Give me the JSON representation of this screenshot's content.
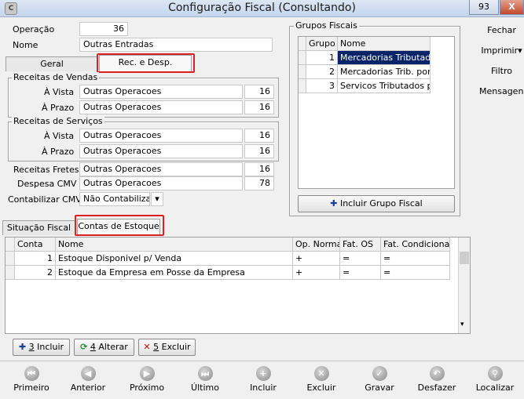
{
  "window": {
    "title": "Configuração Fiscal (Consultando)",
    "app_icon": "C",
    "code_badge": "93",
    "close_glyph": "X"
  },
  "header": {
    "operacao_label": "Operação",
    "operacao_value": "36",
    "nome_label": "Nome",
    "nome_value": "Outras Entradas"
  },
  "top_tabs": [
    {
      "label": "Geral"
    },
    {
      "label": "Rec. e Desp."
    }
  ],
  "receitas_vendas": {
    "title": "Receitas de Vendas",
    "rows": [
      {
        "label": "À Vista",
        "value": "Outras Operacoes",
        "code": "16"
      },
      {
        "label": "À Prazo",
        "value": "Outras Operacoes",
        "code": "16"
      }
    ]
  },
  "receitas_servicos": {
    "title": "Receitas de Serviços",
    "rows": [
      {
        "label": "À Vista",
        "value": "Outras Operacoes",
        "code": "16"
      },
      {
        "label": "À Prazo",
        "value": "Outras Operacoes",
        "code": "16"
      }
    ]
  },
  "extras": {
    "fretes_label": "Receitas Fretes",
    "fretes_value": "Outras Operacoes",
    "fretes_code": "16",
    "cmv_label": "Despesa CMV",
    "cmv_value": "Outras Operacoes",
    "cmv_code": "78",
    "contabilizar_label": "Contabilizar CMV",
    "contabilizar_value": "Não Contabilizar"
  },
  "grupos_fiscais": {
    "title": "Grupos Fiscais",
    "headers": [
      "Grupo",
      "Nome"
    ],
    "rows": [
      {
        "grupo": "1",
        "nome": "Mercadorias Tributadas"
      },
      {
        "grupo": "2",
        "nome": "Mercadorias Trib. por Su"
      },
      {
        "grupo": "3",
        "nome": "Servicos Tributados pel"
      }
    ],
    "button_label": "Incluir Grupo Fiscal"
  },
  "bottom_tabs": [
    {
      "label": "Situação Fiscal"
    },
    {
      "label": "Contas de Estoque"
    }
  ],
  "contas": {
    "headers": [
      "Conta",
      "Nome",
      "Op. Normal",
      "Fat. OS",
      "Fat. Condicional"
    ],
    "rows": [
      {
        "conta": "1",
        "nome": "Estoque Disponivel p/ Venda",
        "op": "+",
        "os": "=",
        "cond": "="
      },
      {
        "conta": "2",
        "nome": "Estoque da Empresa em Posse da Empresa",
        "op": "+",
        "os": "=",
        "cond": "="
      }
    ]
  },
  "actions": {
    "incluir_key": "3",
    "incluir_label": " Incluir",
    "alterar_key": "4",
    "alterar_label": " Alterar",
    "excluir_key": "5",
    "excluir_label": " Excluir"
  },
  "side_menu": {
    "fechar": "Fechar",
    "imprimir": "Imprimir",
    "filtro": "Filtro",
    "mensagens": "Mensagens"
  },
  "nav": [
    {
      "label": "Primeiro",
      "icon": "first-icon"
    },
    {
      "label": "Anterior",
      "icon": "prev-icon"
    },
    {
      "label": "Próximo",
      "icon": "next-icon"
    },
    {
      "label": "Último",
      "icon": "last-icon"
    },
    {
      "label": "Incluir",
      "icon": "plus-icon"
    },
    {
      "label": "Excluir",
      "icon": "x-icon"
    },
    {
      "label": "Gravar",
      "icon": "check-icon"
    },
    {
      "label": "Desfazer",
      "icon": "undo-icon"
    },
    {
      "label": "Localizar",
      "icon": "search-icon"
    }
  ]
}
